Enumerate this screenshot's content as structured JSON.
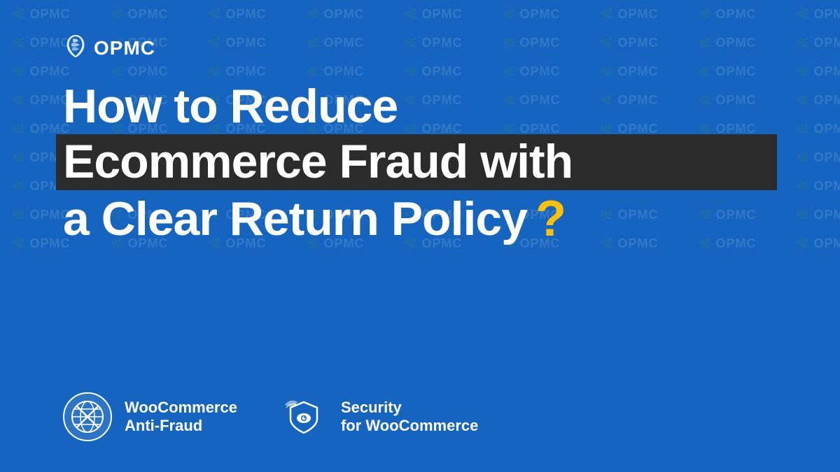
{
  "brand": {
    "logo_text": "OPMC",
    "logo_icon": "leaf-icon"
  },
  "title": {
    "line1": "How to Reduce",
    "line2": "Ecommerce Fraud with",
    "line3": "a Clear Return Policy",
    "question_mark": "?"
  },
  "plugins": [
    {
      "name": "WooCommerce",
      "sub": "Anti-Fraud",
      "icon": "anti-fraud-icon"
    },
    {
      "name": "Security",
      "sub": "for WooCommerce",
      "icon": "security-icon"
    }
  ],
  "watermark": {
    "label": "OPMC",
    "leaf": "❧"
  },
  "colors": {
    "bg": "#1565C0",
    "dark_band": "#2b2b2b",
    "question_mark": "#FFC107",
    "text": "#ffffff"
  }
}
